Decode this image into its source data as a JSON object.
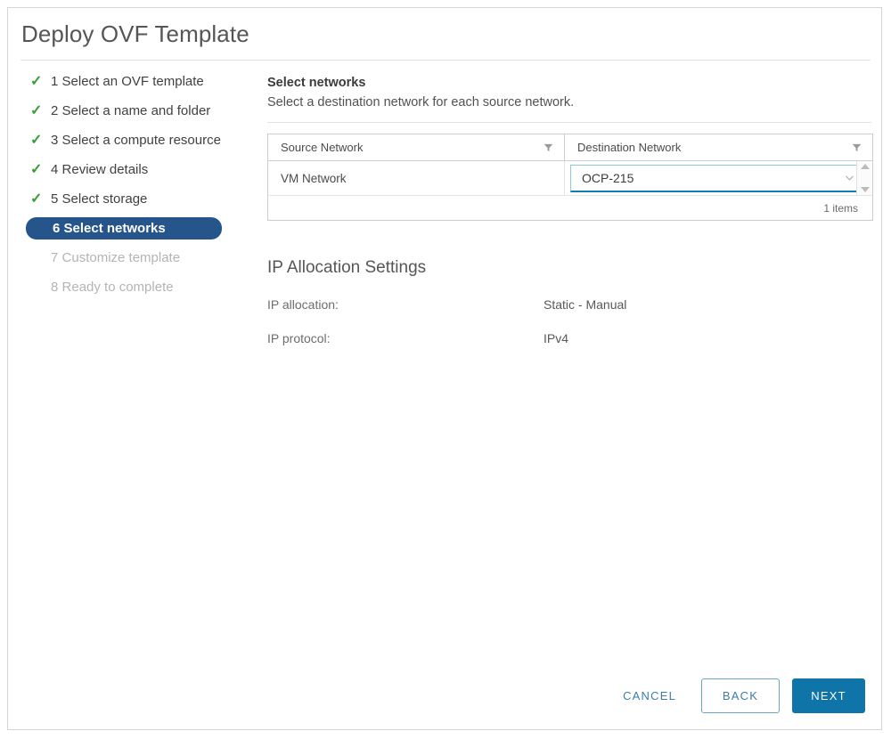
{
  "window": {
    "title": "Deploy OVF Template"
  },
  "steps": [
    {
      "number": "1",
      "label": "Select an OVF template",
      "state": "done"
    },
    {
      "number": "2",
      "label": "Select a name and folder",
      "state": "done"
    },
    {
      "number": "3",
      "label": "Select a compute resource",
      "state": "done"
    },
    {
      "number": "4",
      "label": "Review details",
      "state": "done"
    },
    {
      "number": "5",
      "label": "Select storage",
      "state": "done"
    },
    {
      "number": "6",
      "label": "Select networks",
      "state": "active"
    },
    {
      "number": "7",
      "label": "Customize template",
      "state": "disabled"
    },
    {
      "number": "8",
      "label": "Ready to complete",
      "state": "disabled"
    }
  ],
  "main": {
    "heading": "Select networks",
    "subheading": "Select a destination network for each source network."
  },
  "grid": {
    "columns": [
      {
        "label": "Source Network",
        "filter_icon": "filter-funnel-icon"
      },
      {
        "label": "Destination Network",
        "filter_icon": "filter-funnel-icon"
      }
    ],
    "rows": [
      {
        "source": "VM Network",
        "destination": "OCP-215"
      }
    ],
    "footer_count": "1 items",
    "scrollbar": {
      "up_icon": "triangle-up-icon",
      "down_icon": "triangle-down-icon"
    },
    "dropdown_icon": "chevron-down-icon"
  },
  "ip_allocation": {
    "title": "IP Allocation Settings",
    "rows": [
      {
        "label": "IP allocation:",
        "value": "Static - Manual"
      },
      {
        "label": "IP protocol:",
        "value": "IPv4"
      }
    ]
  },
  "footer": {
    "cancel_label": "CANCEL",
    "back_label": "BACK",
    "next_label": "NEXT"
  },
  "colors": {
    "accent_blue": "#0f74a8",
    "active_step": "#25558a",
    "check_green": "#3c9c35",
    "focus_underline": "#0f7cb4",
    "link_blue": "#3d7ea8"
  }
}
